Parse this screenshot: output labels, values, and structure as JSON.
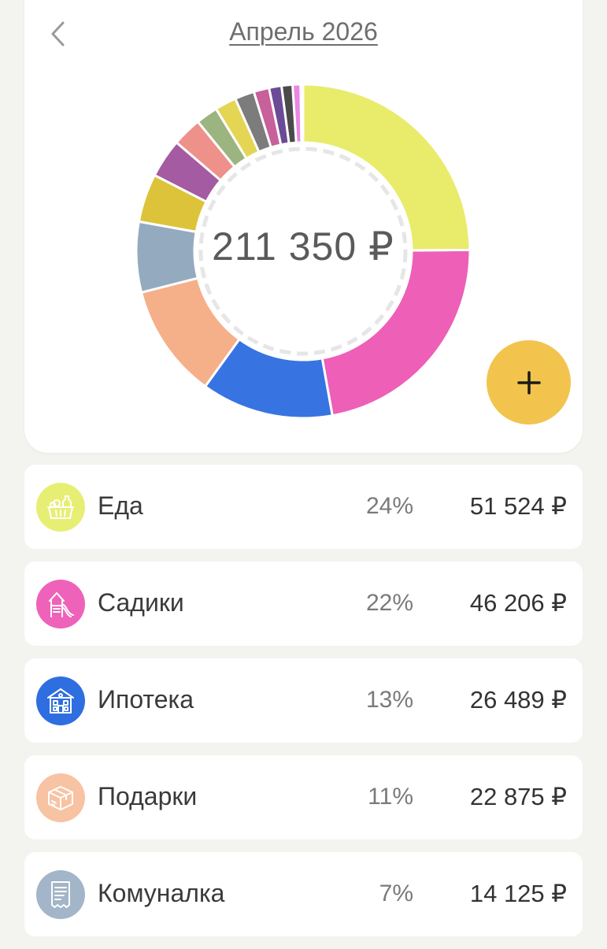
{
  "header": {
    "month_title": "Апрель 2026"
  },
  "summary": {
    "total": "211 350 ₽"
  },
  "chart_data": {
    "type": "donut",
    "total": 211350,
    "slices": [
      {
        "label": "Еда",
        "value": 51524,
        "color": "#e8ec6a"
      },
      {
        "label": "Садики",
        "value": 46206,
        "color": "#ee5fb7"
      },
      {
        "label": "Ипотека",
        "value": 26489,
        "color": "#3774e2"
      },
      {
        "label": "Подарки",
        "value": 22875,
        "color": "#f5b089"
      },
      {
        "label": "Комуналка",
        "value": 14125,
        "color": "#94aabf"
      },
      {
        "value": 9700,
        "color": "#ddc339"
      },
      {
        "value": 7800,
        "color": "#a45ba1"
      },
      {
        "value": 5900,
        "color": "#ee918a"
      },
      {
        "value": 4400,
        "color": "#9cb47f"
      },
      {
        "value": 4300,
        "color": "#e4d554"
      },
      {
        "value": 3900,
        "color": "#7c7c7c"
      },
      {
        "value": 3100,
        "color": "#c8609b"
      },
      {
        "value": 2500,
        "color": "#6b4a96"
      },
      {
        "value": 2200,
        "color": "#4a4a4a"
      },
      {
        "value": 1600,
        "color": "#ea86e4"
      },
      {
        "value": 500,
        "color": "#3554a8"
      }
    ]
  },
  "categories": [
    {
      "name": "Еда",
      "percent": "24%",
      "amount": "51 524 ₽",
      "color": "#e7ee74",
      "icon": "food-basket-icon"
    },
    {
      "name": "Садики",
      "percent": "22%",
      "amount": "46 206 ₽",
      "color": "#ee62ba",
      "icon": "playground-icon"
    },
    {
      "name": "Ипотека",
      "percent": "13%",
      "amount": "26 489 ₽",
      "color": "#2f6ee0",
      "icon": "house-icon"
    },
    {
      "name": "Подарки",
      "percent": "11%",
      "amount": "22 875 ₽",
      "color": "#f7c3a2",
      "icon": "gift-box-icon"
    },
    {
      "name": "Комуналка",
      "percent": "7%",
      "amount": "14 125 ₽",
      "color": "#a3b5c8",
      "icon": "receipt-icon"
    }
  ],
  "icons": {
    "back": "chevron-left-icon",
    "add": "plus-icon"
  },
  "colors": {
    "fab": "#f2c44e",
    "background": "#f3f3ef",
    "card": "#ffffff"
  }
}
